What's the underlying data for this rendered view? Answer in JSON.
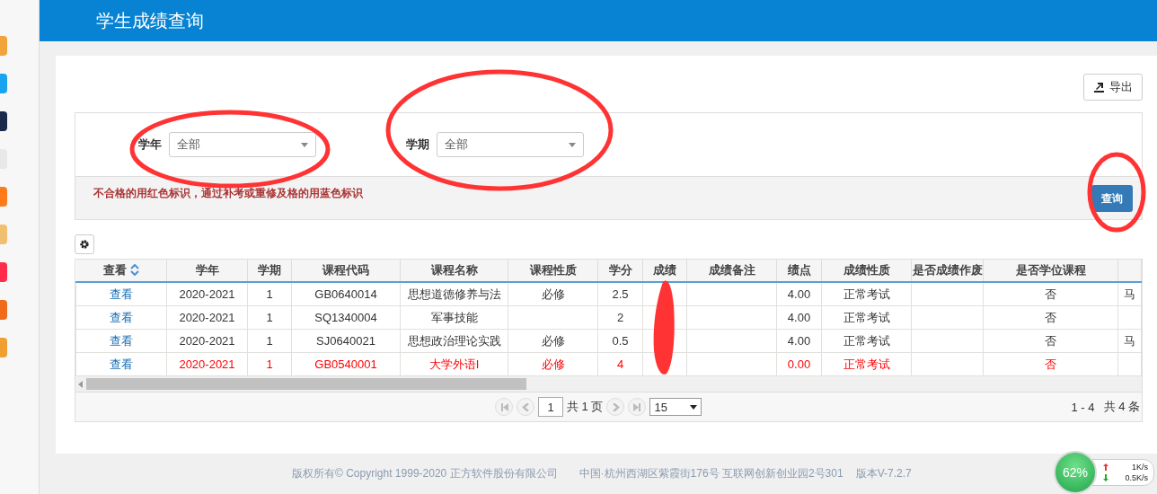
{
  "app_title": "学生成绩查询",
  "export_button": "导出",
  "filters": [
    {
      "label": "学年",
      "value": "全部"
    },
    {
      "label": "学期",
      "value": "全部"
    }
  ],
  "notice": "不合格的用红色标识，通过补考或重修及格的用蓝色标识",
  "query_button": "查询",
  "table": {
    "columns": [
      {
        "label": "查看",
        "sorted": true
      },
      {
        "label": "学年",
        "sorted": false
      },
      {
        "label": "学期",
        "sorted": false
      },
      {
        "label": "课程代码",
        "sorted": false
      },
      {
        "label": "课程名称",
        "sorted": false
      },
      {
        "label": "课程性质",
        "sorted": false
      },
      {
        "label": "学分",
        "sorted": false
      },
      {
        "label": "成绩",
        "sorted": false
      },
      {
        "label": "成绩备注",
        "sorted": false
      },
      {
        "label": "绩点",
        "sorted": false
      },
      {
        "label": "成绩性质",
        "sorted": false
      },
      {
        "label": "是否成绩作废",
        "sorted": false
      },
      {
        "label": "是否学位课程",
        "sorted": false
      },
      {
        "sorted": false
      }
    ],
    "rows": [
      {
        "failed": false,
        "cells": [
          "查看",
          "2020-2021",
          "1",
          "GB0640014",
          "思想道德修养与法",
          "必修",
          "2.5",
          null,
          null,
          "4.00",
          "正常考试",
          null,
          "否",
          "马"
        ]
      },
      {
        "failed": false,
        "cells": [
          "查看",
          "2020-2021",
          "1",
          "SQ1340004",
          "军事技能",
          null,
          "2",
          null,
          null,
          "4.00",
          "正常考试",
          null,
          "否",
          null
        ]
      },
      {
        "failed": false,
        "cells": [
          "查看",
          "2020-2021",
          "1",
          "SJ0640021",
          "思想政治理论实践",
          "必修",
          "0.5",
          null,
          null,
          "4.00",
          "正常考试",
          null,
          "否",
          "马"
        ]
      },
      {
        "failed": true,
        "cells": [
          "查看",
          "2020-2021",
          "1",
          "GB0540001",
          "大学外语I",
          "必修",
          "4",
          null,
          null,
          "0.00",
          "正常考试",
          null,
          "否",
          null
        ]
      }
    ]
  },
  "pagination": {
    "page": "1",
    "total_pages": "共 1 页",
    "page_size": "15",
    "range": "1 - 4",
    "total": "共 4 条"
  },
  "footer": {
    "copyright": "版权所有© Copyright 1999-2020 正方软件股份有限公司",
    "address": "中国·杭州西湖区紫霞街176号 互联网创新创业园2号301",
    "version": "版本V-7.2.7"
  },
  "net_widget": {
    "percent": "62%",
    "up": "1K/s",
    "down": "0.5K/s"
  },
  "annotations": [
    {
      "kind": "ellipse"
    },
    {
      "kind": "ellipse"
    },
    {
      "kind": "ellipse"
    },
    {
      "kind": "scribble"
    }
  ]
}
